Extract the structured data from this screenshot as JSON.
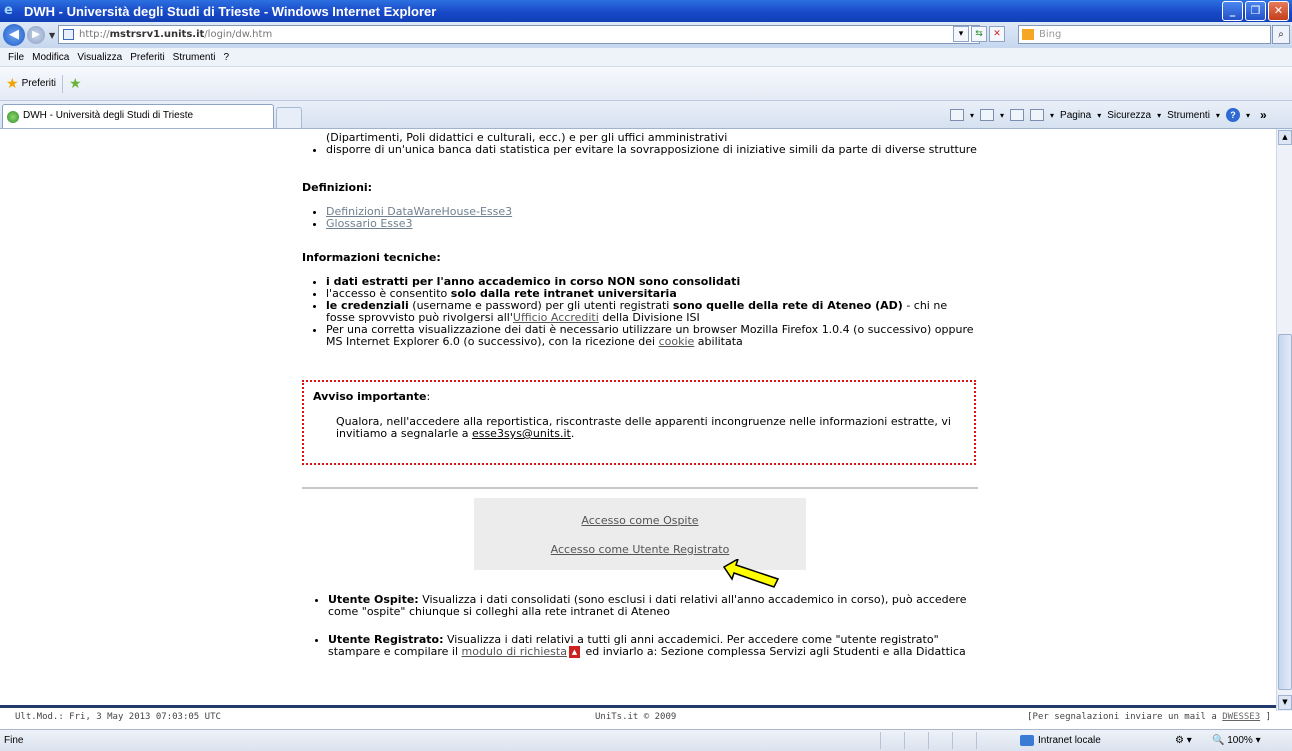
{
  "window": {
    "title": "DWH - Università degli Studi di Trieste - Windows Internet Explorer"
  },
  "address": {
    "url_prefix": "http://",
    "url_host": "mstrsrv1.units.it",
    "url_path": "/login/dw.htm",
    "search_placeholder": "Bing"
  },
  "menu": [
    "File",
    "Modifica",
    "Visualizza",
    "Preferiti",
    "Strumenti",
    "?"
  ],
  "favorites": {
    "label": "Preferiti"
  },
  "tab": {
    "label": "DWH - Università degli Studi di Trieste"
  },
  "commandbar": {
    "pagina": "Pagina",
    "sicurezza": "Sicurezza",
    "strumenti": "Strumenti"
  },
  "content": {
    "top_line": "(Dipartimenti, Poli didattici e culturali, ecc.) e per gli uffici amministrativi",
    "top_bullet": "disporre di un'unica banca dati statistica per evitare la sovrapposizione di iniziative simili da parte di diverse strutture",
    "definizioni_heading": "Definizioni:",
    "definizioni_links": [
      "Definizioni DataWareHouse-Esse3",
      "Glossario Esse3"
    ],
    "info_heading": "Informazioni tecniche:",
    "info1": "i dati estratti per l'anno accademico in corso NON sono consolidati",
    "info2_pre": "l'accesso è consentito ",
    "info2_bold": "solo dalla rete intranet universitaria",
    "info3_bold1": "le credenziali",
    "info3_mid": " (username e password) per gli utenti registrati ",
    "info3_bold2": "sono quelle della rete di Ateneo (AD)",
    "info3_tail": " - chi ne fosse sprovvisto può rivolgersi all'",
    "info3_link": "Ufficio Accrediti",
    "info3_end": " della Divisione ISI",
    "info4_pre": "Per una corretta visualizzazione dei dati è necessario utilizzare un browser Mozilla Firefox 1.0.4 (o successivo) oppure MS Internet Explorer 6.0 (o successivo), con la ricezione dei ",
    "info4_link": "cookie",
    "info4_end": " abilitata",
    "avviso_heading": "Avviso importante",
    "avviso_colon": ":",
    "avviso_text": "Qualora, nell'accedere alla reportistica, riscontraste delle apparenti incongruenze nelle informazioni estratte, vi invitiamo a segnalarle a ",
    "avviso_email": "esse3sys@units.it",
    "avviso_end": ".",
    "access_guest": "Accesso come Ospite",
    "access_registered": "Accesso come Utente Registrato",
    "ospite_bold": "Utente Ospite:",
    "ospite_text": " Visualizza i dati consolidati (sono esclusi i dati relativi all'anno accademico in corso), può accedere come \"ospite\" chiunque si colleghi alla rete intranet di Ateneo",
    "registrato_bold": "Utente Registrato:",
    "registrato_text": " Visualizza i dati relativi a tutti gli anni accademici. Per accedere come \"utente registrato\" stampare e compilare il ",
    "registrato_link": "modulo di richiesta",
    "registrato_end": " ed inviarlo a: Sezione complessa Servizi agli Studenti e alla Didattica"
  },
  "footer": {
    "left": "Ult.Mod.: Fri, 3 May 2013 07:03:05 UTC",
    "center": "UniTs.it © 2009",
    "right_pre": "[Per segnalazioni inviare un mail a ",
    "right_link": "DWESSE3",
    "right_end": " ]"
  },
  "status": {
    "text": "Fine",
    "zone": "Intranet locale",
    "zoom": "100%"
  }
}
